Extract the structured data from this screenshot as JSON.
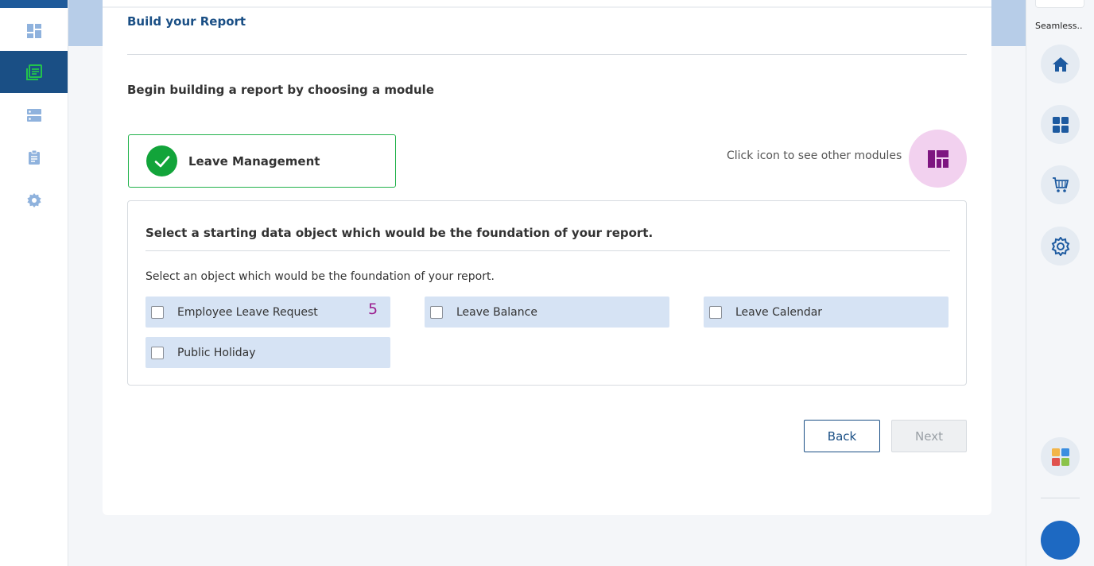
{
  "page": {
    "title": "Build your Report",
    "intro": "Begin building a report by choosing a module"
  },
  "module": {
    "selected": "Leave Management",
    "hint": "Click icon to see other modules"
  },
  "objects": {
    "heading": "Select a starting data object which would be the foundation of your report.",
    "subheading": "Select an object which would be the foundation of your report.",
    "options": [
      {
        "label": "Employee Leave Request",
        "badge": "5",
        "checked": false
      },
      {
        "label": "Leave Balance",
        "checked": false
      },
      {
        "label": "Leave Calendar",
        "checked": false
      },
      {
        "label": "Public Holiday",
        "checked": false
      }
    ]
  },
  "actions": {
    "back": "Back",
    "next": "Next"
  },
  "right_rail": {
    "label": "Seamless...",
    "icons": [
      "home-icon",
      "apps-grid-icon",
      "cart-icon",
      "settings-gear-icon",
      "color-apps-icon"
    ]
  },
  "left_nav": {
    "icons": [
      "dashboard-icon",
      "reports-icon",
      "storage-icon",
      "clipboard-icon",
      "settings-icon"
    ],
    "active_index": 1
  },
  "colors": {
    "primary": "#1a4f85",
    "success": "#12a43a",
    "option_bg": "#d6e3f4",
    "badge": "#9b1f8f",
    "module_switch_bg": "#f2d1ef"
  }
}
